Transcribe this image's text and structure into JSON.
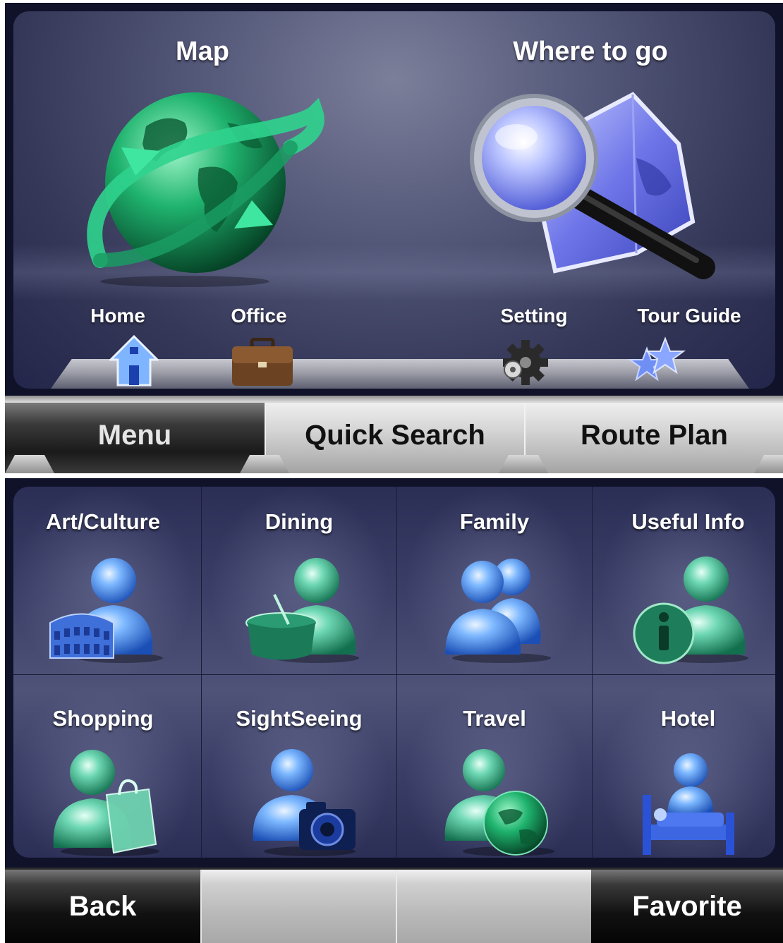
{
  "top": {
    "map_label": "Map",
    "where_label": "Where to go",
    "shortcuts": {
      "home": "Home",
      "office": "Office",
      "setting": "Setting",
      "tour_guide": "Tour Guide"
    }
  },
  "tabs": {
    "menu": "Menu",
    "quick_search": "Quick Search",
    "route_plan": "Route Plan",
    "active": "Menu"
  },
  "categories": [
    {
      "label": "Art/Culture",
      "icon": "art-culture-icon"
    },
    {
      "label": "Dining",
      "icon": "dining-icon"
    },
    {
      "label": "Family",
      "icon": "family-icon"
    },
    {
      "label": "Useful Info",
      "icon": "useful-info-icon"
    },
    {
      "label": "Shopping",
      "icon": "shopping-icon"
    },
    {
      "label": "SightSeeing",
      "icon": "sightseeing-icon"
    },
    {
      "label": "Travel",
      "icon": "travel-icon"
    },
    {
      "label": "Hotel",
      "icon": "hotel-icon"
    }
  ],
  "bottom": {
    "back": "Back",
    "favorite": "Favorite"
  },
  "colors": {
    "panel_dark": "#10122a",
    "panel_mid": "#4f5378",
    "blue_figure": "#5a9cf0",
    "green_figure": "#3fb59a"
  }
}
